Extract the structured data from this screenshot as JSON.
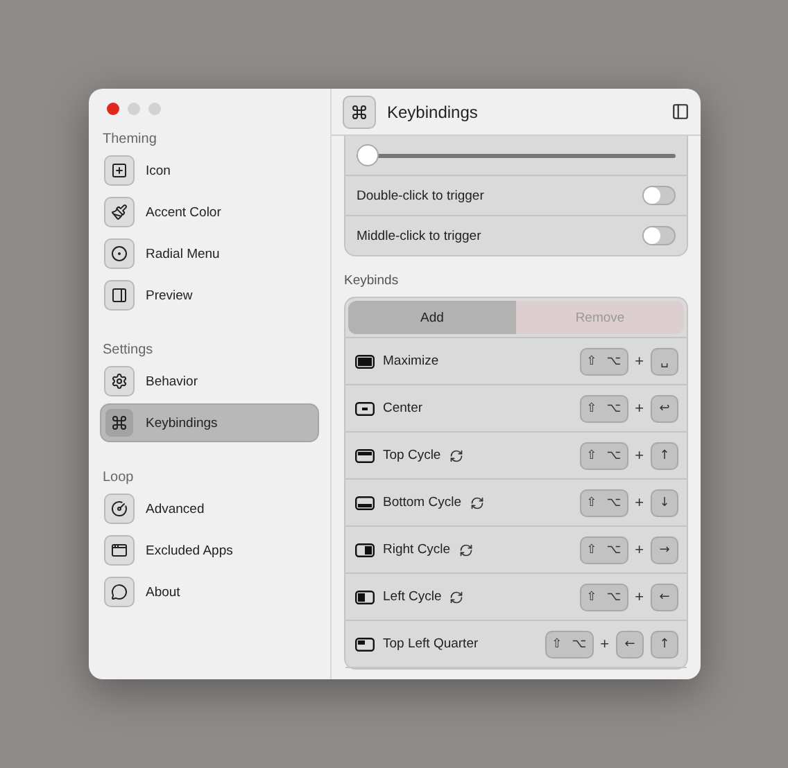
{
  "window": {
    "traffic_lights": [
      {
        "kind": "close"
      },
      {
        "kind": "minimize"
      },
      {
        "kind": "zoom"
      }
    ]
  },
  "sidebar": {
    "sections": [
      {
        "title": "Theming",
        "items": [
          {
            "label": "Icon",
            "selected": false
          },
          {
            "label": "Accent Color",
            "selected": false
          },
          {
            "label": "Radial Menu",
            "selected": false
          },
          {
            "label": "Preview",
            "selected": false
          }
        ]
      },
      {
        "title": "Settings",
        "items": [
          {
            "label": "Behavior",
            "selected": false
          },
          {
            "label": "Keybindings",
            "selected": true
          }
        ]
      },
      {
        "title": "Loop",
        "items": [
          {
            "label": "Advanced",
            "selected": false
          },
          {
            "label": "Excluded Apps",
            "selected": false
          },
          {
            "label": "About",
            "selected": false
          }
        ]
      }
    ]
  },
  "header": {
    "title": "Keybindings"
  },
  "trigger_settings": {
    "slider": {
      "level": 0.0
    },
    "toggles": [
      {
        "label": "Double-click to trigger",
        "on": false
      },
      {
        "label": "Middle-click to trigger",
        "on": false
      }
    ]
  },
  "keybinds": {
    "title": "Keybinds",
    "buttons": [
      {
        "label": "Add",
        "kind": "add"
      },
      {
        "label": "Remove",
        "kind": "remove"
      }
    ],
    "rows": [
      {
        "label": "Maximize",
        "cycle": false,
        "modifiers": [
          "⇧",
          "⌥"
        ],
        "plus": "+",
        "keys": [
          "␣"
        ]
      },
      {
        "label": "Center",
        "cycle": false,
        "modifiers": [
          "⇧",
          "⌥"
        ],
        "plus": "+",
        "keys": [
          "↩"
        ]
      },
      {
        "label": "Top Cycle",
        "cycle": true,
        "modifiers": [
          "⇧",
          "⌥"
        ],
        "plus": "+",
        "keys": [
          "↑"
        ]
      },
      {
        "label": "Bottom Cycle",
        "cycle": true,
        "modifiers": [
          "⇧",
          "⌥"
        ],
        "plus": "+",
        "keys": [
          "↓"
        ]
      },
      {
        "label": "Right Cycle",
        "cycle": true,
        "modifiers": [
          "⇧",
          "⌥"
        ],
        "plus": "+",
        "keys": [
          "→"
        ]
      },
      {
        "label": "Left Cycle",
        "cycle": true,
        "modifiers": [
          "⇧",
          "⌥"
        ],
        "plus": "+",
        "keys": [
          "←"
        ]
      },
      {
        "label": "Top Left Quarter",
        "cycle": false,
        "modifiers": [
          "⇧",
          "⌥"
        ],
        "plus": "+",
        "keys": [
          "←",
          "↑"
        ]
      }
    ]
  }
}
